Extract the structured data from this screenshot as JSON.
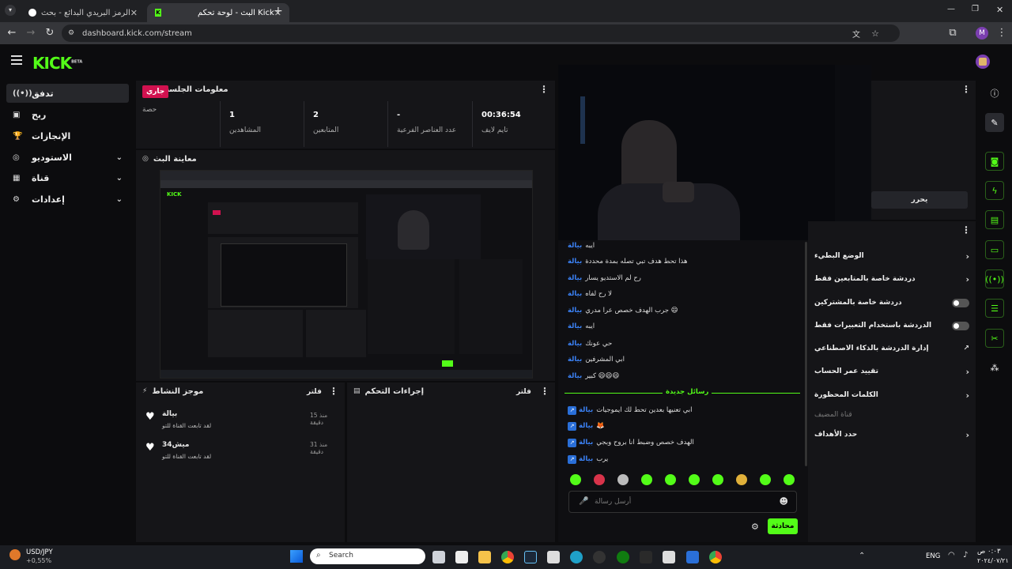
{
  "browser": {
    "tabs": [
      {
        "title": "الرمز البريدي البدائع - بحث Google"
      },
      {
        "title": "البث - لوحة تحكم Kick"
      }
    ],
    "url": "dashboard.kick.com/stream",
    "profile_initial": "M"
  },
  "app": {
    "logo": "KICK",
    "logo_beta": "BETA"
  },
  "leftnav": {
    "items": [
      {
        "label": "تدفق",
        "icon": "stream-icon"
      },
      {
        "label": "ربح",
        "icon": "monetize-icon"
      },
      {
        "label": "الإنجازات",
        "icon": "trophy-icon"
      },
      {
        "label": "الاستوديو",
        "icon": "studio-icon"
      },
      {
        "label": "قناة",
        "icon": "channel-icon"
      },
      {
        "label": "إعدادات",
        "icon": "gear-icon"
      }
    ]
  },
  "session": {
    "title": "معلومات الجلسة",
    "live_badge": "جاري",
    "live_label": "حصة",
    "viewers_value": "1",
    "viewers_label": "المشاهدين",
    "followers_value": "2",
    "followers_label": "المتابعين",
    "sub_value": "-",
    "sub_label": "عدد العناصر الفرعية",
    "uptime_value": "00:36:54",
    "uptime_label": "تايم لايف"
  },
  "preview": {
    "title": "معاينة البث"
  },
  "activity": {
    "title": "موجز النشاط",
    "filter": "فلتر",
    "items": [
      {
        "user": "بيالة",
        "text": "لقد تابعت القناة للتو",
        "time": "منذ 15 دقيقة"
      },
      {
        "user": "ميش34",
        "text": "لقد تابعت القناة للتو",
        "time": "منذ 31 دقيقة"
      }
    ]
  },
  "moderation": {
    "title": "إجراءات التحكم",
    "filter": "فلتر"
  },
  "chat": {
    "messages": [
      {
        "user": "بيالة",
        "text": "ايبه"
      },
      {
        "user": "بيالة",
        "text": "هذا تحط هدف تبي تصله بمدة محددة"
      },
      {
        "user": "بيالة",
        "text": "رح لم الاستديو يسار"
      },
      {
        "user": "بيالة",
        "text": "لا رح لفاه"
      },
      {
        "user": "بيالة",
        "text": "جرب الهدف خصص عرا مدري 😄"
      },
      {
        "user": "بيالة",
        "text": "ايبه"
      },
      {
        "user": "بيالة",
        "text": "حي عونك"
      },
      {
        "user": "بيالة",
        "text": "ابي المشرفين"
      },
      {
        "user": "بيالة",
        "text": "كبير 😄😄😄"
      }
    ],
    "new_messages_label": "رسائل جديدة",
    "new_messages": [
      {
        "user": "بيالة",
        "text": "ابي تعنيها بعدين تحط لك ايموجيات"
      },
      {
        "user": "بيالة",
        "text": "🦊"
      },
      {
        "user": "بيالة",
        "text": "الهدف خصص وضبط انا بروح وبجي"
      },
      {
        "user": "بيالة",
        "text": "يرب"
      }
    ],
    "input_placeholder": "أرسل رسالة",
    "send_label": "محادثة"
  },
  "chat_settings": {
    "edit_label": "يحرر",
    "items": [
      {
        "label": "الوضع البطيء",
        "control": "chevron"
      },
      {
        "label": "دردشة خاصة بالمتابعين فقط",
        "control": "chevron"
      },
      {
        "label": "دردشة خاصة بالمشتركين",
        "control": "toggle"
      },
      {
        "label": "الدردشة باستخدام التعبيرات فقط",
        "control": "toggle"
      },
      {
        "label": "إدارة الدردشة بالذكاء الاصطناعي",
        "control": "external"
      },
      {
        "label": "تقييد عمر الحساب",
        "control": "chevron"
      },
      {
        "label": "الكلمات المحظورة",
        "control": "chevron"
      },
      {
        "label": "قناة المضيف",
        "control": "none"
      },
      {
        "label": "حدد الأهداف",
        "control": "chevron"
      }
    ]
  },
  "taskbar": {
    "ticker_symbol": "USD/JPY",
    "ticker_change": "+0,55%",
    "search_placeholder": "Search",
    "lang": "ENG",
    "time": "٠:٠٣ ص",
    "date": "٢٠٢٤/٠٧/٢١"
  }
}
